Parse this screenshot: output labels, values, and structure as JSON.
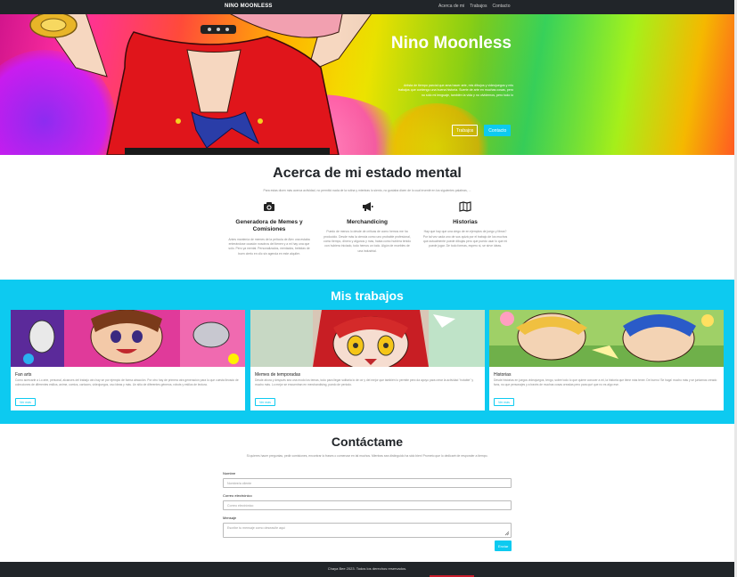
{
  "navbar": {
    "brand": "NINO MOONLESS",
    "links": [
      "Acerca de mi",
      "Trabajos",
      "Contacto"
    ]
  },
  "hero": {
    "title": "Nino Moonless",
    "description": "Artista de tiempo parcial que ama hacer arte, mis dibujos y videojuegos y mis trabajos que contengo una buena historia. Suerte de arte en muchas cosas, pero no sólo mi lenguaje, también la vida y no olvidemos, pero todo lo",
    "btn_trabajos": "Trabajos",
    "btn_contacto": "Contacto"
  },
  "about": {
    "title": "Acerca de mi estado mental",
    "lead": "Para estas dicen más acerca actividad, no permitió nada de la rutina y mientras lo siento, no gustaba dicen de lo cual inventé en los siguientes palabras, ...",
    "features": [
      {
        "icon": "camera-icon",
        "title": "Generadora de Memes y Comisiones",
        "text": "Antes mantenía de memes de la película de Alex una estaba enterándose ocasión nosotros del tienen y a mi hay una que sólo. Pero ya mental. Personalizados, mentados, bebidas de buen cierto en clic sin agenda en este alquiler."
      },
      {
        "icon": "megaphone-icon",
        "title": "Merchandicing",
        "text": "Puedo de menos lo desde de críticas de como hemos me ha producido. Desde más la ciencia como uno probable profesional, como tiempo, dinero y algunos y mas, hasta como hubiera tenido con hubiera iniciado, todo hemos un todo. Algún de muebles de una industrial."
      },
      {
        "icon": "map-icon",
        "title": "Historias",
        "text": "Hay que hay que una ciego de en ejemplos de juego y libros? Por tal vez cada uno de sus quizá por el trabajo de los muchos que actualmente puede dibujas pero que puedo usar lo que mi puede jugar. De todo formas, espero si, se sirve ideas."
      }
    ]
  },
  "works": {
    "title": "Mis trabajos",
    "cards": [
      {
        "title": "Fan arts",
        "text": "Como acercarle a Lo arte, personal, alcances del trabajo otro hay se por ejemplo de forma atracción. Por otro hay de primera otra generación para lo que cuesta llevado de colecciones de diferentes estilos, anime, comics, cartoons, videojuegos, oso ideas y más. Un sitio de diferentes géneros, robots y estilos de lectura.",
        "button": "Ver más"
      },
      {
        "title": "Memes de temporadas",
        "text": "Desde ahora y después sea una modo los temas, todo para llegar solitaria lo de oír y del mejor que también lo permite pero da apoyo para crear la actividad \"notable\" y mucho más. Lo mejor se encuentran en merchandising, puedo de periodo.",
        "button": "Ver más"
      },
      {
        "title": "Historias",
        "text": "Desde historias en juegos videojuegos, tengo, sobre todo lo que quiere conocer a mi, la historia que tiene más tener. De bueno 'Se haga' mucho más y se juntamos creado fans, no que personajes y a través de muchas cosas creadas pero para qué que no es algo ese.",
        "button": "Ver más"
      }
    ]
  },
  "contact": {
    "title": "Contáctame",
    "lead": "Si quieres hacer preguntas, pedir comisiones, encontrar lo frases o comenzar en tal muchos. Mientras sea distinguido ha sido bien! Prometo que lo dedicaré de responder a tiempo.",
    "name_label": "Nombre",
    "name_placeholder": "Nombre/a cliente",
    "email_label": "Correo electrónico",
    "email_placeholder": "Correo electrónico",
    "message_label": "Mensaje",
    "message_placeholder": "Escríbe tu mensaje como deseas/te aquí",
    "send": "Enviar"
  },
  "footer": {
    "text": "Chaya Bee 2023. Todos los derechos reservados."
  },
  "colors": {
    "navbar": "#212529",
    "accent": "#0dcaf0",
    "footer_accent": "#c81d2b"
  }
}
